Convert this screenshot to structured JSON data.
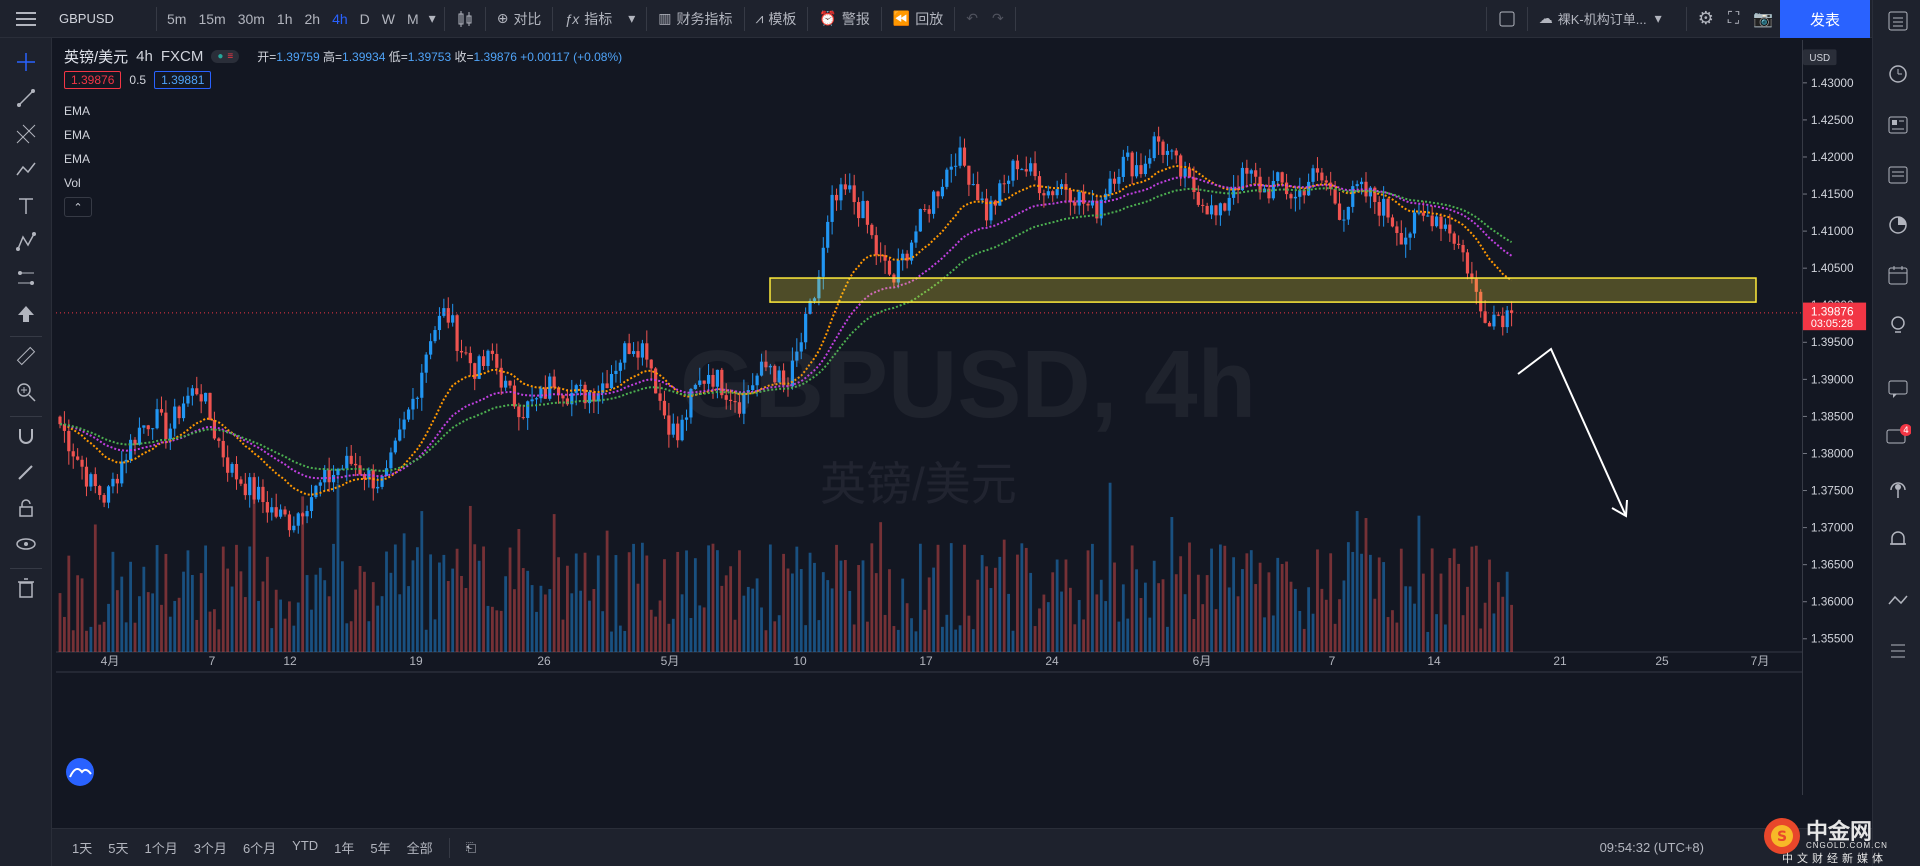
{
  "topbar": {
    "symbol": "GBPUSD",
    "intervals": [
      "5m",
      "15m",
      "30m",
      "1h",
      "2h",
      "4h",
      "D",
      "W",
      "M"
    ],
    "active_interval": "4h",
    "compare": "对比",
    "indicators": "指标",
    "financials": "财务指标",
    "templates": "模板",
    "alert": "警报",
    "replay": "回放",
    "layout_name": "裸K-机构订单...",
    "publish": "发表"
  },
  "legend": {
    "title": "英镑/美元",
    "interval": "4h",
    "source": "FXCM",
    "open_label": "开=",
    "open": "1.39759",
    "high_label": "高=",
    "high": "1.39934",
    "low_label": "低=",
    "low": "1.39753",
    "close_label": "收=",
    "close": "1.39876",
    "change": "+0.00117 (+0.08%)",
    "bid": "1.39876",
    "spread": "0.5",
    "ask": "1.39881",
    "indicators": [
      "EMA",
      "EMA",
      "EMA",
      "Vol"
    ]
  },
  "watermark": {
    "symbol": "GBPUSD, 4h",
    "name": "英镑/美元"
  },
  "price_axis": {
    "currency": "USD",
    "labels": [
      "1.43000",
      "1.42500",
      "1.42000",
      "1.41500",
      "1.41000",
      "1.40500",
      "1.40000",
      "1.39500",
      "1.39000",
      "1.38500",
      "1.38000",
      "1.37500",
      "1.37000",
      "1.36500",
      "1.36000",
      "1.35500"
    ],
    "current_price": "1.39876",
    "countdown": "03:05:28"
  },
  "time_axis": {
    "labels": [
      "4月",
      "7",
      "12",
      "19",
      "26",
      "5月",
      "10",
      "17",
      "24",
      "6月",
      "7",
      "14",
      "21",
      "25",
      "7月"
    ]
  },
  "bottombar": {
    "ranges": [
      "1天",
      "5天",
      "1个月",
      "3个月",
      "6个月",
      "YTD",
      "1年",
      "5年",
      "全部"
    ],
    "clock": "09:54:32 (UTC+8)"
  },
  "brand": {
    "name": "中金网",
    "url": "CNGOLD.COM.CN",
    "tagline": "中文财经新媒体"
  },
  "colors": {
    "up": "#2196f3",
    "down": "#ef5350",
    "ema_fast": "#ff9800",
    "ema_mid": "#c040e0",
    "ema_slow": "#4caf50",
    "zone": "#ffeb3b",
    "accent": "#2962ff"
  },
  "chart_data": {
    "type": "candlestick",
    "symbol": "GBPUSD",
    "interval": "4h",
    "ylim": [
      1.355,
      1.43
    ],
    "close_path": [
      1.384,
      1.38,
      1.376,
      1.374,
      1.379,
      1.383,
      1.385,
      1.383,
      1.387,
      1.389,
      1.383,
      1.378,
      1.376,
      1.374,
      1.372,
      1.371,
      1.374,
      1.376,
      1.378,
      1.379,
      1.377,
      1.376,
      1.382,
      1.388,
      1.396,
      1.399,
      1.394,
      1.391,
      1.393,
      1.388,
      1.386,
      1.387,
      1.39,
      1.388,
      1.388,
      1.389,
      1.392,
      1.395,
      1.394,
      1.386,
      1.382,
      1.388,
      1.391,
      1.389,
      1.387,
      1.39,
      1.392,
      1.388,
      1.395,
      1.402,
      1.413,
      1.415,
      1.412,
      1.406,
      1.403,
      1.408,
      1.412,
      1.416,
      1.42,
      1.417,
      1.412,
      1.415,
      1.419,
      1.417,
      1.415,
      1.416,
      1.414,
      1.412,
      1.417,
      1.419,
      1.418,
      1.422,
      1.419,
      1.416,
      1.414,
      1.411,
      1.416,
      1.417,
      1.415,
      1.416,
      1.414,
      1.417,
      1.416,
      1.412,
      1.415,
      1.414,
      1.412,
      1.409,
      1.411,
      1.412,
      1.41,
      1.406,
      1.399,
      1.3985,
      1.39876
    ]
  }
}
